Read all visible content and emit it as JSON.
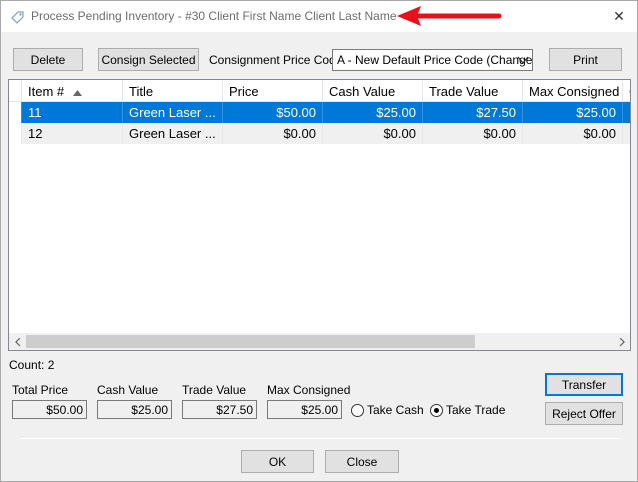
{
  "window": {
    "title": "Process Pending Inventory - #30 Client First Name Client Last Name",
    "close_glyph": "✕"
  },
  "toolbar": {
    "delete_label": "Delete",
    "consign_label": "Consign Selected",
    "price_code_label": "Consignment Price Code",
    "price_code_value": "A - New Default Price Code (Changec",
    "print_label": "Print"
  },
  "grid": {
    "columns": [
      "Item #",
      "Title",
      "Price",
      "Cash Value",
      "Trade Value",
      "Max Consigned",
      "C"
    ],
    "rows": [
      {
        "item": "11",
        "title": "Green Laser ...",
        "price": "$50.00",
        "cash": "$25.00",
        "trade": "$27.50",
        "max": "$25.00",
        "extra": ""
      },
      {
        "item": "12",
        "title": "Green Laser ...",
        "price": "$0.00",
        "cash": "$0.00",
        "trade": "$0.00",
        "max": "$0.00",
        "extra": ""
      }
    ],
    "count_label": "Count: 2"
  },
  "totals": {
    "total_price_label": "Total Price",
    "total_price": "$50.00",
    "cash_value_label": "Cash Value",
    "cash_value": "$25.00",
    "trade_value_label": "Trade Value",
    "trade_value": "$27.50",
    "max_consigned_label": "Max Consigned",
    "max_consigned": "$25.00"
  },
  "options": {
    "take_cash_label": "Take Cash",
    "take_trade_label": "Take Trade",
    "selected": "take_trade"
  },
  "actions": {
    "transfer_label": "Transfer",
    "reject_label": "Reject Offer",
    "ok_label": "OK",
    "close_label": "Close"
  },
  "colors": {
    "selection": "#0078d7",
    "annotation_arrow": "#e8101a"
  }
}
